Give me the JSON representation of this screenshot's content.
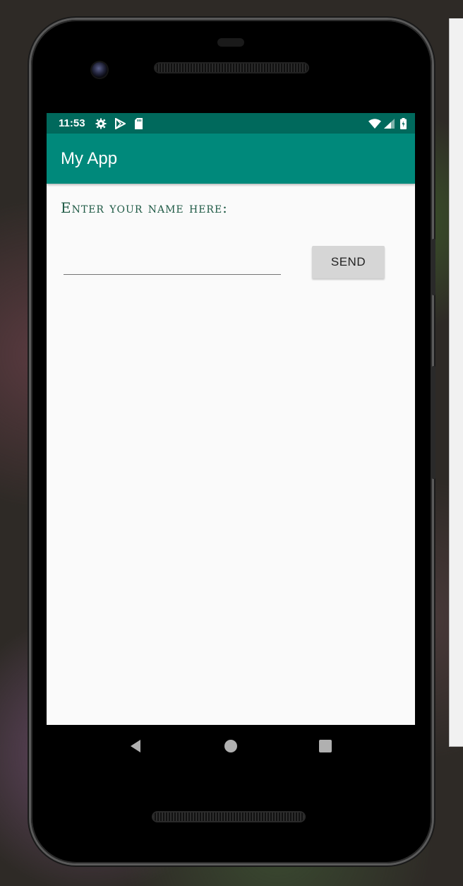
{
  "status_bar": {
    "time": "11:53",
    "icons_left": [
      "settings-icon",
      "play-store-icon",
      "sd-card-icon"
    ],
    "icons_right": [
      "wifi-icon",
      "cell-signal-icon",
      "battery-icon"
    ]
  },
  "app_bar": {
    "title": "My App"
  },
  "main": {
    "prompt": "Enter your name here:",
    "name_input": {
      "value": "",
      "placeholder": ""
    },
    "send_button": "SEND"
  },
  "nav_bar": {
    "icons": [
      "back-icon",
      "home-icon",
      "recents-icon"
    ]
  },
  "colors": {
    "status_bar": "#00695c",
    "app_bar": "#00897b",
    "prompt_text": "#1f5a45",
    "button": "#d6d6d6"
  }
}
